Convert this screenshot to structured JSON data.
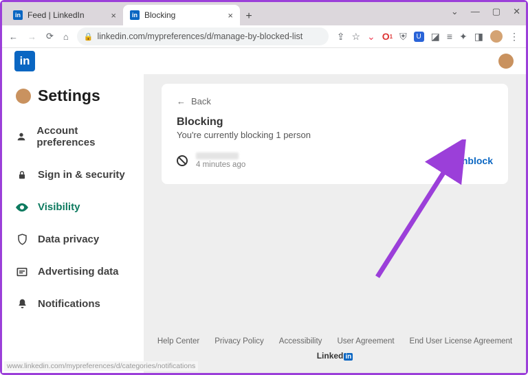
{
  "tabs": [
    {
      "title": "Feed | LinkedIn",
      "active": false
    },
    {
      "title": "Blocking",
      "active": true
    }
  ],
  "url": "linkedin.com/mypreferences/d/manage-by-blocked-list",
  "settings_label": "Settings",
  "nav": [
    {
      "label": "Account preferences"
    },
    {
      "label": "Sign in & security"
    },
    {
      "label": "Visibility"
    },
    {
      "label": "Data privacy"
    },
    {
      "label": "Advertising data"
    },
    {
      "label": "Notifications"
    }
  ],
  "back_label": "Back",
  "blocking": {
    "title": "Blocking",
    "subtitle": "You're currently blocking 1 person",
    "item_time": "4 minutes ago",
    "unblock_label": "Unblock"
  },
  "footer": {
    "links": [
      "Help Center",
      "Privacy Policy",
      "Accessibility",
      "User Agreement",
      "End User License Agreement"
    ],
    "brand": "Linked"
  },
  "status_url": "www.linkedin.com/mypreferences/d/categories/notifications"
}
